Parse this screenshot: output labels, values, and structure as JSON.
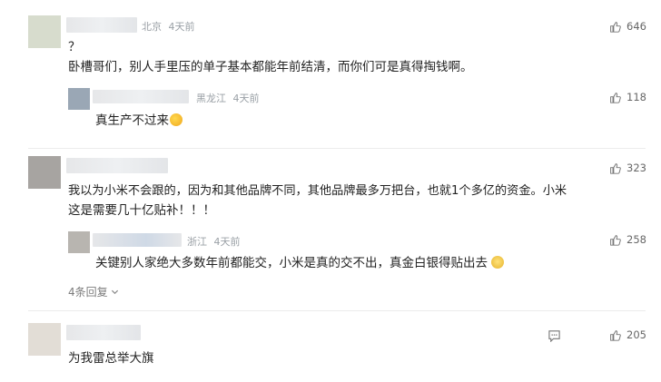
{
  "comments": [
    {
      "location": "北京",
      "time": "4天前",
      "likes": "646",
      "text_line1": "？",
      "text_line2": "卧槽哥们，别人手里压的单子基本都能年前结清，而你们可是真得掏钱啊。",
      "replies": [
        {
          "location": "黑龙江",
          "time": "4天前",
          "likes": "118",
          "text": "真生产不过来"
        }
      ]
    },
    {
      "likes": "323",
      "text_line1": "我以为小米不会跟的，因为和其他品牌不同，其他品牌最多万把台，也就1个多亿的资金。小米",
      "text_line2": "这是需要几十亿贴补！！！",
      "replies": [
        {
          "location": "浙江",
          "time": "4天前",
          "likes": "258",
          "text": "关键别人家绝大多数年前都能交，小米是真的交不出，真金白银得贴出去"
        }
      ],
      "more_replies": "4条回复"
    },
    {
      "likes": "205",
      "text": "为我雷总举大旗"
    }
  ],
  "icons": {
    "like": "thumbs-up-icon",
    "reply": "comment-icon",
    "expand": "chevron-down-icon",
    "emoji_tired": "tired-face-emoji-icon",
    "emoji_cat": "cat-face-emoji-icon"
  },
  "colors": {
    "meta": "#9aa0a6",
    "text": "#222222",
    "divider": "#ececec"
  }
}
